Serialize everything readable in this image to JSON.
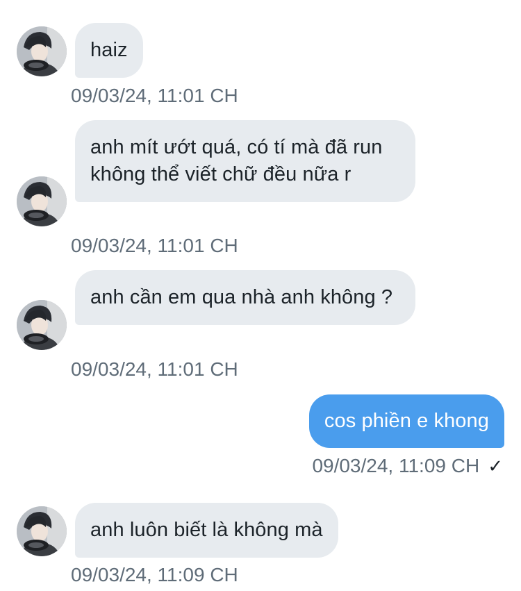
{
  "messages": [
    {
      "direction": "incoming",
      "text": "haiz",
      "time": "09/03/24, 11:01 CH"
    },
    {
      "direction": "incoming",
      "text": "anh mít ướt quá, có tí mà đã run không thể viết chữ đều nữa r",
      "time": "09/03/24, 11:01 CH"
    },
    {
      "direction": "incoming",
      "text": "anh cần em qua nhà anh không ?",
      "time": "09/03/24, 11:01 CH"
    },
    {
      "direction": "outgoing",
      "text": "cos phiền e khong",
      "time": "09/03/24, 11:09 CH",
      "status_icon": "✓"
    },
    {
      "direction": "incoming",
      "text": "anh luôn biết là không mà",
      "time": "09/03/24, 11:09 CH"
    }
  ],
  "colors": {
    "incoming_bubble": "#e7ebef",
    "outgoing_bubble": "#4a9ded",
    "timestamp": "#5f6c78",
    "text": "#1c2329"
  },
  "icons": {
    "avatar": "contact-avatar-image",
    "read_status": "checkmark-icon"
  }
}
